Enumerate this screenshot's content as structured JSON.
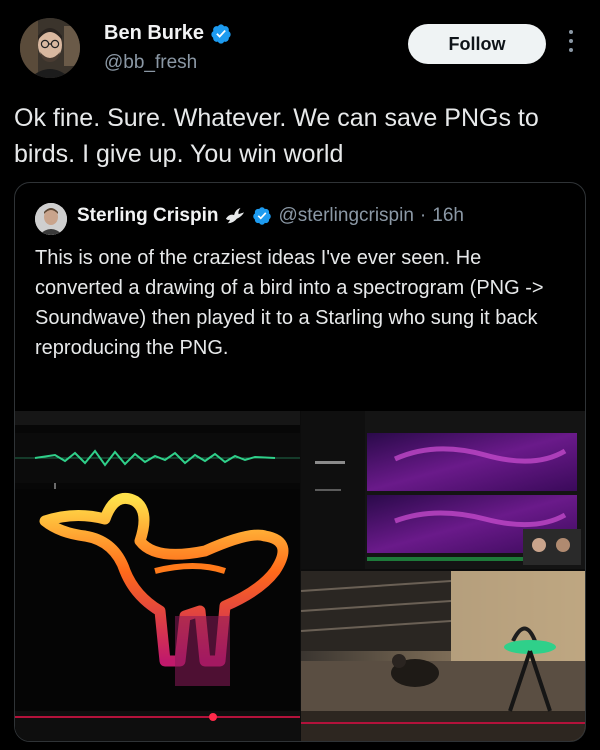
{
  "author": {
    "name": "Ben Burke",
    "handle": "@bb_fresh",
    "avatar_icon": "person-avatar",
    "verified_icon": "verified-badge-icon"
  },
  "actions": {
    "follow_label": "Follow",
    "more_icon": "more-vertical-icon"
  },
  "tweet": {
    "text": "Ok fine. Sure. Whatever. We can save PNGs to birds. I give up. You win world"
  },
  "quote": {
    "name": "Sterling Crispin",
    "dove_icon": "dove-icon",
    "verified_icon": "verified-badge-icon",
    "handle": "@sterlingcrispin",
    "separator": "·",
    "time": "16h",
    "text": "This is one of the craziest ideas I've ever seen. He converted a drawing of a bird into a spectrogram (PNG -> Soundwave) then played it to a Starling who sung it back reproducing the PNG.",
    "more": "..."
  },
  "colors": {
    "background": "#000000",
    "text": "#e7e9ea",
    "muted": "#8b98a5",
    "verified": "#1d9bf0",
    "follow_bg": "#eff3f4",
    "border": "#2f3336"
  }
}
